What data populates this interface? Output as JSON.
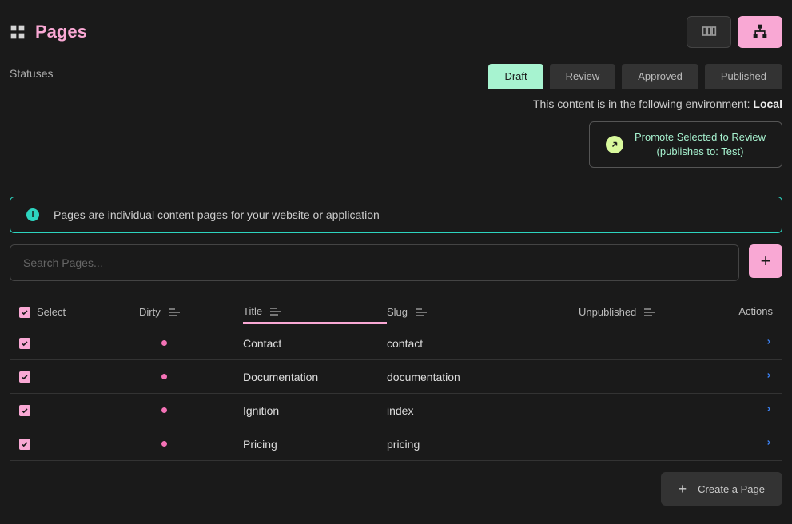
{
  "header": {
    "title": "Pages"
  },
  "statuses": {
    "label": "Statuses",
    "tabs": [
      "Draft",
      "Review",
      "Approved",
      "Published"
    ],
    "active": "Draft"
  },
  "environment": {
    "prefix": "This content is in the following environment: ",
    "name": "Local"
  },
  "promote": {
    "line1": "Promote Selected to Review",
    "line2": "(publishes to: Test)"
  },
  "info": {
    "text": "Pages are individual content pages for your website or application"
  },
  "search": {
    "placeholder": "Search Pages..."
  },
  "columns": {
    "select": "Select",
    "dirty": "Dirty",
    "title": "Title",
    "slug": "Slug",
    "unpublished": "Unpublished",
    "actions": "Actions"
  },
  "rows": [
    {
      "selected": true,
      "dirty": true,
      "title": "Contact",
      "slug": "contact",
      "unpublished": ""
    },
    {
      "selected": true,
      "dirty": true,
      "title": "Documentation",
      "slug": "documentation",
      "unpublished": ""
    },
    {
      "selected": true,
      "dirty": true,
      "title": "Ignition",
      "slug": "index",
      "unpublished": ""
    },
    {
      "selected": true,
      "dirty": true,
      "title": "Pricing",
      "slug": "pricing",
      "unpublished": ""
    }
  ],
  "footer": {
    "create": "Create a Page"
  }
}
